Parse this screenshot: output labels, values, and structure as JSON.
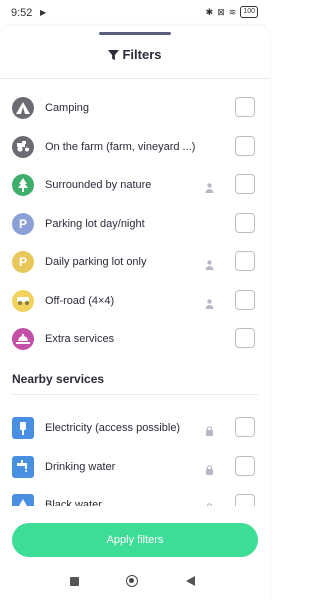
{
  "status": {
    "time": "9:52",
    "battery": "100"
  },
  "title": "Filters",
  "filters": [
    {
      "label": "Camping",
      "icon": "tent-icon",
      "color": "#6b6b73",
      "locked": false,
      "checked": false
    },
    {
      "label": "On the farm (farm, vineyard ...)",
      "icon": "tractor-icon",
      "color": "#6b6b73",
      "locked": false,
      "checked": false
    },
    {
      "label": "Surrounded by nature",
      "icon": "tree-icon",
      "color": "#3fae6a",
      "locked": true,
      "checked": false
    },
    {
      "label": "Parking lot day/night",
      "icon": "parking-icon",
      "color": "#8aa0d6",
      "glyph": "P",
      "locked": false,
      "checked": false
    },
    {
      "label": "Daily parking lot only",
      "icon": "parking-icon",
      "color": "#e8c85a",
      "glyph": "P",
      "locked": true,
      "checked": false
    },
    {
      "label": "Off-road (4×4)",
      "icon": "offroad-icon",
      "color": "#f2d25c",
      "locked": true,
      "checked": false
    },
    {
      "label": "Extra services",
      "icon": "services-icon",
      "color": "#c44fa6",
      "locked": false,
      "checked": false
    }
  ],
  "nearby_title": "Nearby services",
  "nearby": [
    {
      "label": "Electricity (access possible)",
      "icon": "electricity-icon",
      "color": "#4a90e2",
      "locked": true,
      "checked": false
    },
    {
      "label": "Drinking water",
      "icon": "tap-icon",
      "color": "#4a90e2",
      "locked": true,
      "checked": false
    },
    {
      "label": "Black water",
      "icon": "black-water-icon",
      "color": "#4a90e2",
      "locked": true,
      "checked": false
    }
  ],
  "apply_label": "Apply filters",
  "colors": {
    "accent": "#3ddc97",
    "text": "#2b2b3a"
  }
}
